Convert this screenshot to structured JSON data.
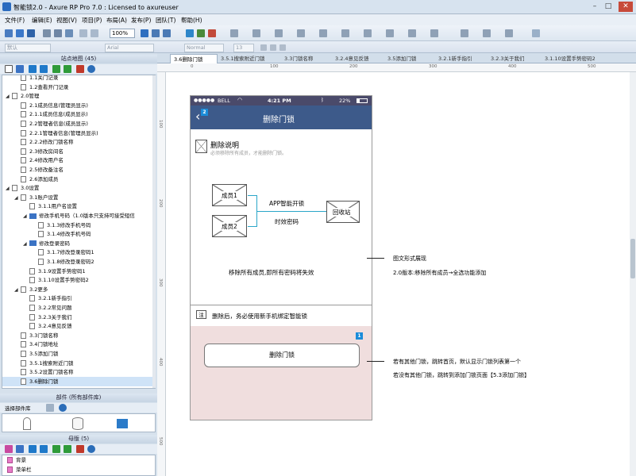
{
  "window": {
    "title": "智能锁2.0 - Axure RP Pro 7.0 : Licensed to axureuser"
  },
  "menu": [
    "文件(F)",
    "编辑(E)",
    "视图(V)",
    "项目(P)",
    "布局(A)",
    "发布(P)",
    "团队(T)",
    "帮助(H)"
  ],
  "toolbar": {
    "zoom": "100%",
    "font_field": "默认",
    "font_name": "Arial",
    "font_style": "Normal",
    "font_size": "13"
  },
  "sitemap": {
    "title": "站点地图 (45)",
    "items": [
      {
        "label": "1.1关门记录",
        "indent": 2,
        "kind": "page"
      },
      {
        "label": "1.2查看开门记录",
        "indent": 2,
        "kind": "page"
      },
      {
        "label": "2.0管理",
        "indent": 1,
        "kind": "page",
        "expanded": true
      },
      {
        "label": "2.1成员信息(管理员显示)",
        "indent": 2,
        "kind": "page"
      },
      {
        "label": "2.1.1成员信息(成员显示)",
        "indent": 2,
        "kind": "page"
      },
      {
        "label": "2.2管理者信息(成员显示)",
        "indent": 2,
        "kind": "page"
      },
      {
        "label": "2.2.1管理者信息(管理员显示)",
        "indent": 2,
        "kind": "page"
      },
      {
        "label": "2.2.2修改门锁名称",
        "indent": 2,
        "kind": "page"
      },
      {
        "label": "2.3修改房间名",
        "indent": 2,
        "kind": "page"
      },
      {
        "label": "2.4修改用户名",
        "indent": 2,
        "kind": "page"
      },
      {
        "label": "2.5修改备注名",
        "indent": 2,
        "kind": "page"
      },
      {
        "label": "2.6添加成员",
        "indent": 2,
        "kind": "page"
      },
      {
        "label": "3.0设置",
        "indent": 1,
        "kind": "page",
        "expanded": true
      },
      {
        "label": "3.1账户设置",
        "indent": 2,
        "kind": "page",
        "expanded": true
      },
      {
        "label": "3.1.1用户名设置",
        "indent": 3,
        "kind": "page"
      },
      {
        "label": "修改手机号码（1.0版本只支持可接受短信",
        "indent": 3,
        "kind": "folder",
        "expanded": true
      },
      {
        "label": "3.1.3修改手机号码",
        "indent": 4,
        "kind": "page"
      },
      {
        "label": "3.1.4修改手机号码",
        "indent": 4,
        "kind": "page"
      },
      {
        "label": "修改登录密码",
        "indent": 3,
        "kind": "folder",
        "expanded": true
      },
      {
        "label": "3.1.7修改登录密码1",
        "indent": 4,
        "kind": "page"
      },
      {
        "label": "3.1.8修改登录密码2",
        "indent": 4,
        "kind": "page"
      },
      {
        "label": "3.1.9设置手势密码1",
        "indent": 3,
        "kind": "page"
      },
      {
        "label": "3.1.10设置手势密码2",
        "indent": 3,
        "kind": "page"
      },
      {
        "label": "3.2更多",
        "indent": 2,
        "kind": "page",
        "expanded": true
      },
      {
        "label": "3.2.1新手指引",
        "indent": 3,
        "kind": "page"
      },
      {
        "label": "3.2.2常见问题",
        "indent": 3,
        "kind": "page"
      },
      {
        "label": "3.2.3关于我们",
        "indent": 3,
        "kind": "page"
      },
      {
        "label": "3.2.4意见反馈",
        "indent": 3,
        "kind": "page"
      },
      {
        "label": "3.3门锁名称",
        "indent": 2,
        "kind": "page"
      },
      {
        "label": "3.4门锁地址",
        "indent": 2,
        "kind": "page"
      },
      {
        "label": "3.5添加门锁",
        "indent": 2,
        "kind": "page"
      },
      {
        "label": "3.5.1搜索附近门锁",
        "indent": 2,
        "kind": "page"
      },
      {
        "label": "3.5.2设置门锁名称",
        "indent": 2,
        "kind": "page"
      },
      {
        "label": "3.6删除门锁",
        "indent": 2,
        "kind": "page",
        "selected": true
      }
    ]
  },
  "widgets": {
    "title": "部件 (所有部件库)",
    "filter_label": "选择部件库"
  },
  "masters": {
    "title": "母版 (5)",
    "items": [
      "背景",
      "菜单栏"
    ]
  },
  "tabs": [
    "3.6删除门锁",
    "3.5.1搜索附近门锁",
    "3.3门锁名称",
    "3.2.4意见反馈",
    "3.5添加门锁",
    "3.2.1新手指引",
    "3.2.3关于我们",
    "3.1.10设置手势密码2"
  ],
  "ruler_h": [
    "0",
    "100",
    "200",
    "300",
    "400",
    "500"
  ],
  "ruler_v": [
    "100",
    "200",
    "300",
    "400",
    "500"
  ],
  "phone": {
    "status": {
      "carrier": "BELL",
      "time": "4:21 PM",
      "battery": "22%"
    },
    "nav_title": "删除门锁",
    "nav_badge": "2",
    "desc_title": "删除说明",
    "desc_sub": "必须移除所有成员，才能删除门锁。",
    "member1": "成员1",
    "member2": "成员2",
    "app_unlock": "APP智能开锁",
    "temp_pwd": "时效密码",
    "recycle": "回收站",
    "warn_text": "移除所有成员,即所有密码将失效",
    "note_label": "注",
    "note_text": "删除后，务必使用新手机绑定智能锁",
    "button": "删除门锁",
    "button_badge": "1"
  },
  "annotations": {
    "a1": "图文形式展现",
    "a2": "2.0版本:移除所有成员→全选功能添加",
    "b1": "若有其他门锁，跳转首页，默认显示门锁列表第一个",
    "b2": "若没有其他门锁，跳转到添加门锁页面【5.3添加门锁】"
  },
  "colors": {
    "nav": "#3d5a8a",
    "status": "#4a4a6a",
    "button_area": "#f0dede",
    "badge": "#1b8cd9",
    "connector": "#2aa6c9"
  }
}
